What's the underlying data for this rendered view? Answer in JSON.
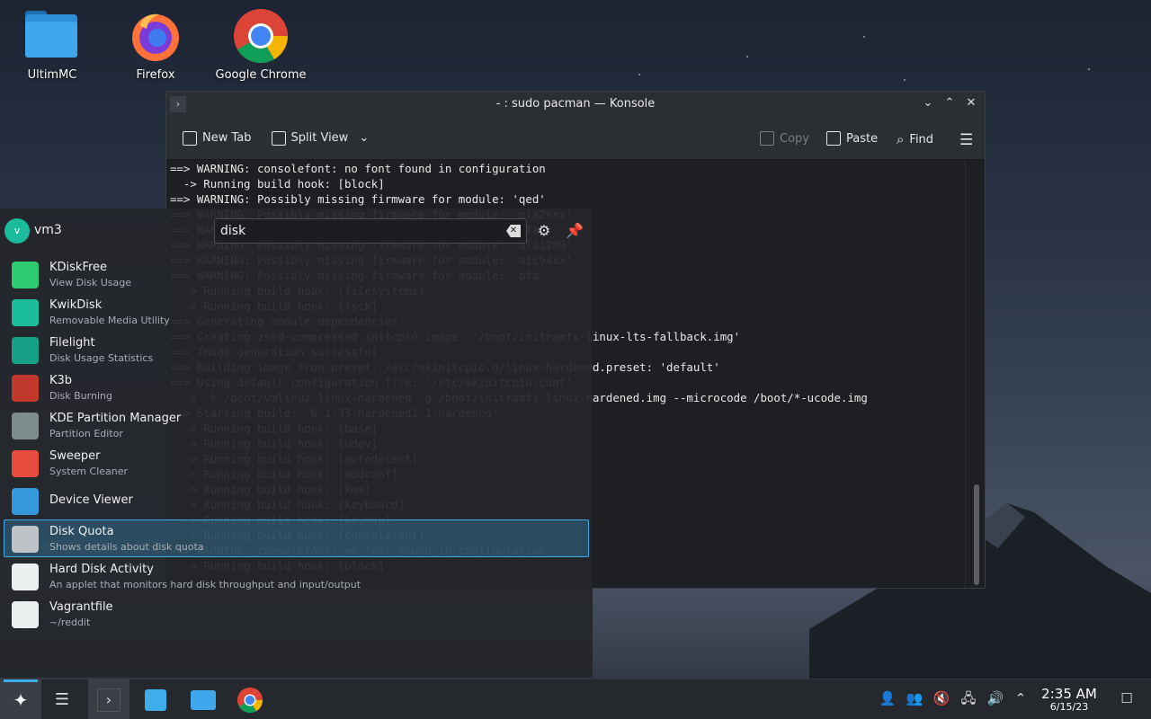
{
  "desktop": {
    "icons": [
      {
        "label": "UltimMC",
        "icon": "folder-icon"
      },
      {
        "label": "Firefox",
        "icon": "firefox-icon"
      },
      {
        "label": "Google Chrome",
        "icon": "chrome-icon"
      }
    ]
  },
  "konsole": {
    "title": "- : sudo pacman — Konsole",
    "toolbar": {
      "new_tab": "New Tab",
      "split_view": "Split View",
      "copy": "Copy",
      "paste": "Paste",
      "find": "Find"
    },
    "lines": [
      "==> WARNING: consolefont: no font found in configuration",
      "  -> Running build hook: [block]",
      "==> WARNING: Possibly missing firmware for module: 'qed'",
      "==> WARNING: Possibly missing firmware for module: 'qla2xxx'",
      "==> WARNING: Possibly missing firmware for module: 'bfa'",
      "==> WARNING: Possibly missing firmware for module: 'qla1280'",
      "==> WARNING: Possibly missing firmware for module: 'aic94xx'",
      "==> WARNING: Possibly missing firmware for module: 'bfa'",
      "  -> Running build hook: [filesystems]",
      "  -> Running build hook: [fsck]",
      "==> Generating module dependencies",
      "==> Creating zstd-compressed initcpio image: '/boot/initramfs-linux-lts-fallback.img'",
      "==> Image generation successful",
      "==> Building image from preset: /etc/mkinitcpio.d/linux-hardened.preset: 'default'",
      "==> Using default configuration file: '/etc/mkinitcpio.conf'",
      "  -> -k /boot/vmlinuz-linux-hardened -g /boot/initramfs-linux-hardened.img --microcode /boot/*-ucode.img",
      "==> Starting build: '6.1.33-hardened1-1-hardened'",
      "  -> Running build hook: [base]",
      "  -> Running build hook: [udev]",
      "  -> Running build hook: [autodetect]",
      "  -> Running build hook: [modconf]",
      "  -> Running build hook: [kms]",
      "  -> Running build hook: [keyboard]",
      "  -> Running build hook: [keymap]",
      "  -> Running build hook: [consolefont]",
      "==> WARNING: consolefont: no font found in configuration",
      "  -> Running build hook: [block]"
    ]
  },
  "launcher": {
    "user": {
      "initial": "v",
      "name": "vm3"
    },
    "search": {
      "value": "disk"
    },
    "results": [
      {
        "name": "KDiskFree",
        "desc": "View Disk Usage",
        "icon": "kdiskfree-icon",
        "color": "#2ecc71"
      },
      {
        "name": "KwikDisk",
        "desc": "Removable Media Utility",
        "icon": "kwikdisk-icon",
        "color": "#1abc9c"
      },
      {
        "name": "Filelight",
        "desc": "Disk Usage Statistics",
        "icon": "filelight-icon",
        "color": "#16a085"
      },
      {
        "name": "K3b",
        "desc": "Disk Burning",
        "icon": "k3b-icon",
        "color": "#c0392b"
      },
      {
        "name": "KDE Partition Manager",
        "desc": "Partition Editor",
        "icon": "partition-manager-icon",
        "color": "#7f8c8d"
      },
      {
        "name": "Sweeper",
        "desc": "System Cleaner",
        "icon": "sweeper-icon",
        "color": "#e74c3c"
      },
      {
        "name": "Device Viewer",
        "desc": "",
        "icon": "device-viewer-icon",
        "color": "#3498db"
      },
      {
        "name": "Disk Quota",
        "desc": "Shows details about disk quota",
        "icon": "disk-quota-icon",
        "color": "#bdc3c7"
      },
      {
        "name": "Hard Disk Activity",
        "desc": "An applet that monitors hard disk throughput and input/output",
        "icon": "hard-disk-activity-icon",
        "color": "#ecf0f1"
      },
      {
        "name": "Vagrantfile",
        "desc": "~/reddit",
        "icon": "text-file-icon",
        "color": "#ecf0f1"
      }
    ],
    "selected_index": 7
  },
  "taskbar": {
    "clock": {
      "time": "2:35 AM",
      "date": "6/15/23"
    }
  },
  "colors": {
    "accent": "#3daee9",
    "panel": "#25282c"
  }
}
